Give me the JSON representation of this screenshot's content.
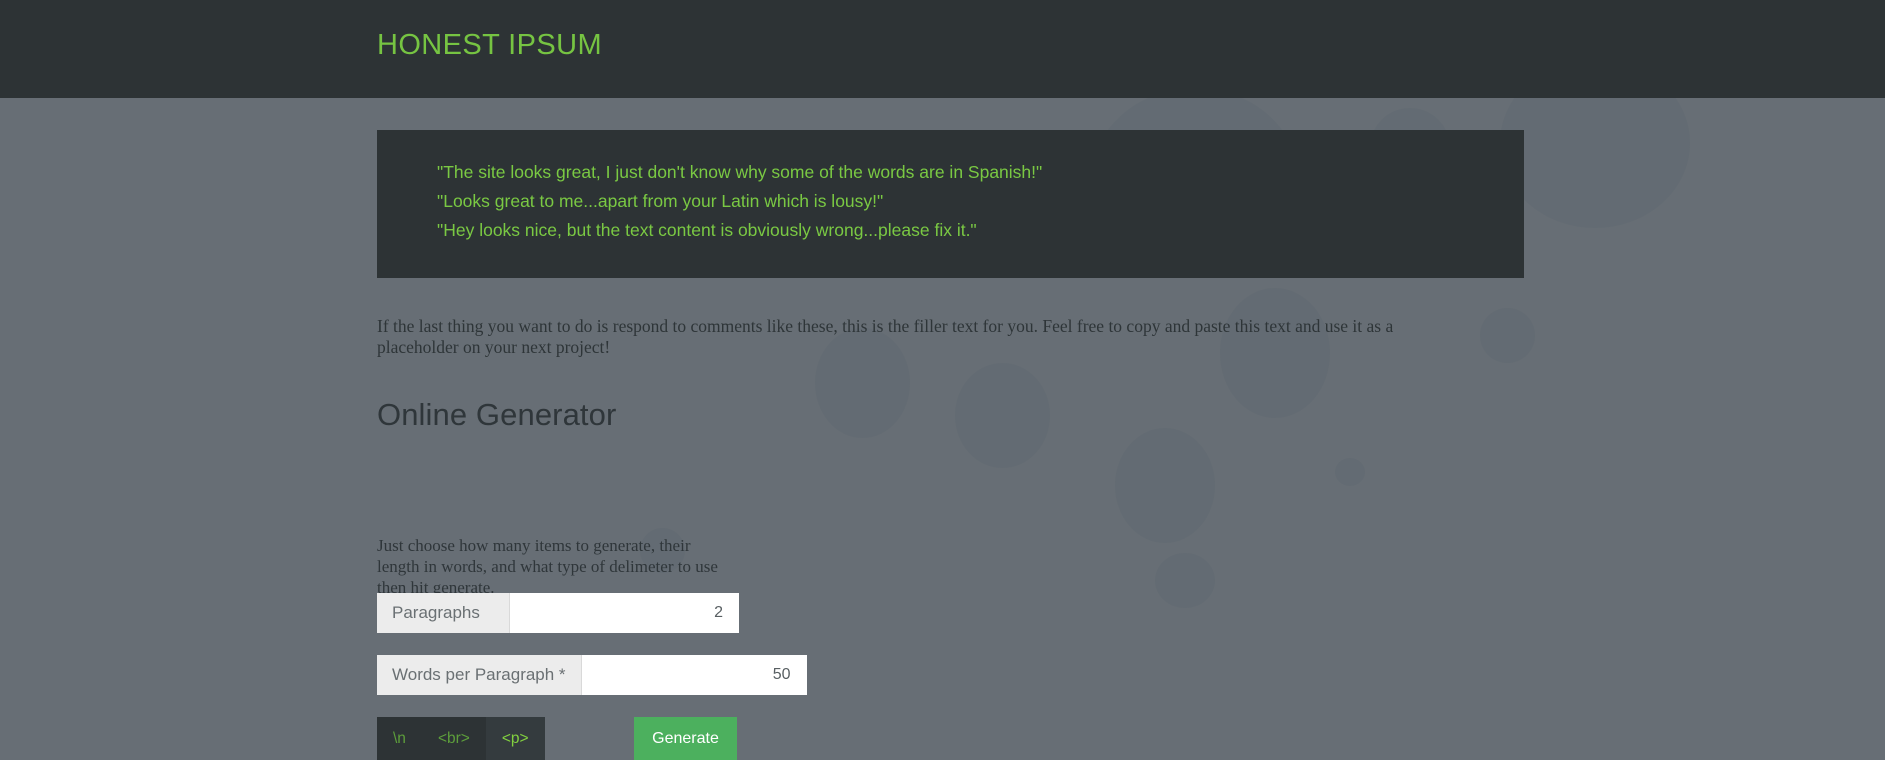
{
  "header": {
    "title": "HONEST IPSUM",
    "background_color": "#2d3335",
    "title_color": "#76c442"
  },
  "page": {
    "background_color": "#676e75"
  },
  "quotes": {
    "background_color": "#2d3335",
    "text_color": "#7ac943",
    "lines": [
      "\"The site looks great, I just don't know why some of the words are in Spanish!\"",
      "\"Looks great to me...apart from your Latin which is lousy!\"",
      "\"Hey looks nice, but the text content is obviously wrong...please fix it.\""
    ]
  },
  "intro": {
    "paragraph": "If the last thing you want to do is respond to comments like these, this is the filler text for you. Feel free to copy and paste this text and use it as a placeholder on your next project!"
  },
  "generator": {
    "heading": "Online Generator",
    "description": "Just choose how many items to generate, their length in words, and what type of delimeter to use then hit generate.",
    "fields": [
      {
        "label": "Paragraphs",
        "value": "2",
        "placeholder": ""
      },
      {
        "label": "Words per Paragraph *",
        "value": "50",
        "placeholder": ""
      }
    ],
    "delimiters": [
      {
        "label": "\\n",
        "active": false
      },
      {
        "label": "<br>",
        "active": false
      },
      {
        "label": "<p>",
        "active": true
      }
    ],
    "generate_label": "Generate",
    "generate_color": "#4cb05e"
  }
}
